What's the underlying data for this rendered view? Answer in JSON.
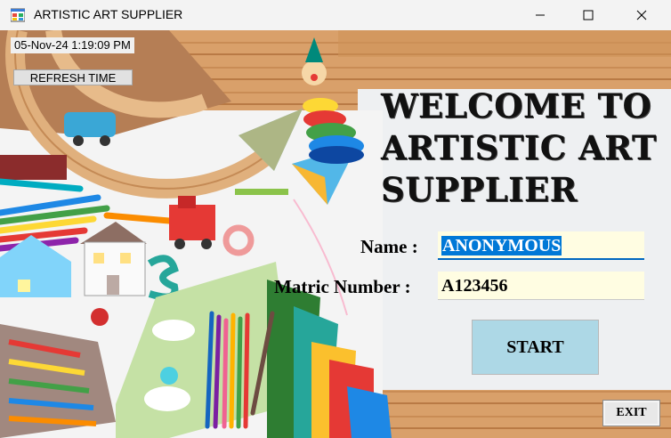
{
  "window": {
    "title": "ARTISTIC ART SUPPLIER",
    "icon": "windows-forms-icon",
    "controls": [
      "minimize-icon",
      "maximize-icon",
      "close-icon"
    ]
  },
  "clock": {
    "timestamp": "05-Nov-24 1:19:09 PM",
    "refresh_label": "REFRESH TIME"
  },
  "welcome": {
    "line1": "WELCOME TO",
    "line2": "ARTISTIC ART",
    "line3": "SUPPLIER"
  },
  "form": {
    "name_label": "Name :",
    "name_value": "ANONYMOUS",
    "matric_label": "Matric Number :",
    "matric_value": "A123456"
  },
  "buttons": {
    "start": "START",
    "exit": "EXIT"
  },
  "colors": {
    "start_button": "#add8e6",
    "input_background": "#fffde2",
    "selection": "#0078d7",
    "panel": "#f0f2f4",
    "wood": "#d9a06a"
  }
}
